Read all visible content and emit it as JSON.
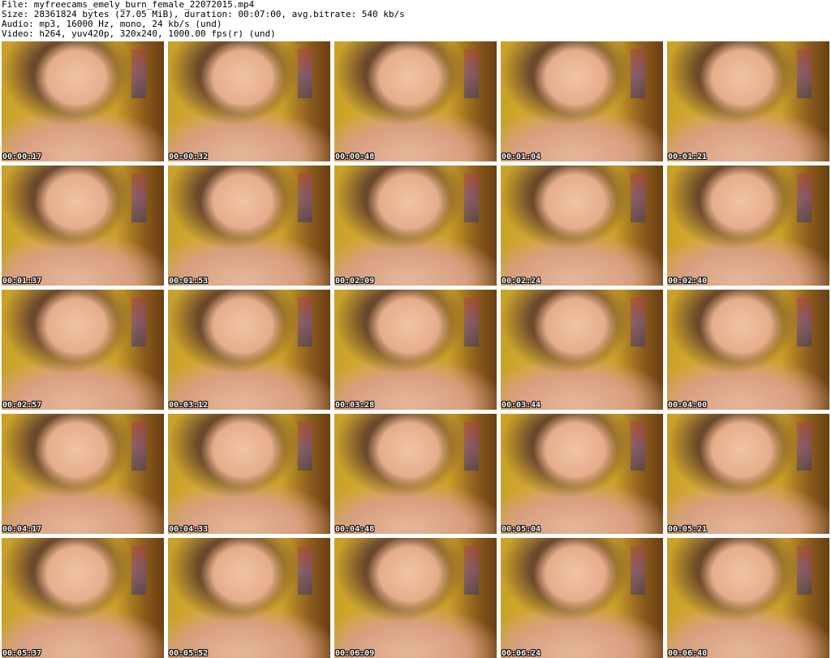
{
  "header": {
    "file": "File: myfreecams_emely_burn_female_22072015.mp4",
    "size": "Size: 28361824 bytes (27.05 MiB), duration: 00:07:00, avg.bitrate: 540 kb/s",
    "audio": "Audio: mp3, 16000 Hz, mono, 24 kb/s (und)",
    "video": "Video: h264, yuv420p, 320x240, 1000.00 fps(r) (und)"
  },
  "thumbnails": [
    "00:00:17",
    "00:00:32",
    "00:00:48",
    "00:01:04",
    "00:01:21",
    "00:01:37",
    "00:01:53",
    "00:02:09",
    "00:02:24",
    "00:02:40",
    "00:02:57",
    "00:03:12",
    "00:03:28",
    "00:03:44",
    "00:04:00",
    "00:04:17",
    "00:04:33",
    "00:04:48",
    "00:05:04",
    "00:05:21",
    "00:05:37",
    "00:05:52",
    "00:06:09",
    "00:06:24",
    "00:06:40"
  ]
}
